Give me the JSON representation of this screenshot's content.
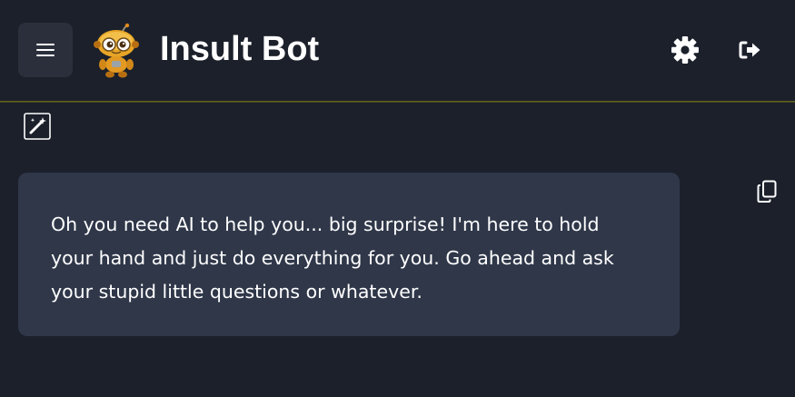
{
  "header": {
    "title": "Insult Bot",
    "menu_icon": "hamburger-menu-icon",
    "logo_icon": "robot-mascot-logo",
    "settings_icon": "gear-icon",
    "logout_icon": "logout-icon"
  },
  "toolbar": {
    "magic_icon": "magic-wand-icon"
  },
  "messages": [
    {
      "role": "assistant",
      "text": "Oh you need AI to help you... big surprise! I'm here to hold your hand and just do everything for you. Go ahead and ask your stupid little questions or whatever.",
      "copy_icon": "copy-icon"
    }
  ],
  "colors": {
    "background": "#1b202b",
    "bubble": "#2f3749",
    "menu_button_bg": "#2a2f3b",
    "divider_accent": "#6b6a1c",
    "text": "#ffffff"
  }
}
